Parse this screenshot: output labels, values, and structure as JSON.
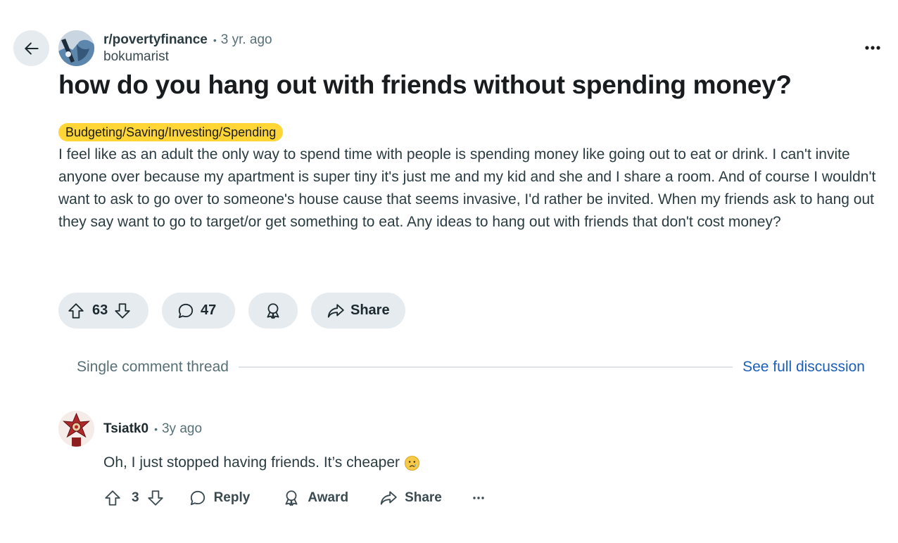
{
  "post": {
    "subreddit": "r/povertyfinance",
    "time_ago": "3 yr. ago",
    "author": "bokumarist",
    "title": "how do you hang out with friends without spending money?",
    "flair": "Budgeting/Saving/Investing/Spending",
    "body": "I feel like as an adult the only way to spend time with people is spending money like going out to eat or drink. I can't invite anyone over because my apartment is super tiny it's just me and my kid and she and I share a room. And of course I wouldn't want to ask to go over to someone's house cause that seems invasive, I'd rather be invited. When my friends ask to hang out they say want to go to target/or get something to eat. Any ideas to hang out with friends that don't cost money?",
    "upvotes": "63",
    "comments": "47",
    "share_label": "Share"
  },
  "thread": {
    "label": "Single comment thread",
    "see_full": "See full discussion"
  },
  "comment": {
    "author": "Tsiatk0",
    "time_ago": "3y ago",
    "body": "Oh, I just stopped having friends. It’s cheaper",
    "emoji": "crying-face-emoji",
    "upvotes": "3",
    "reply_label": "Reply",
    "award_label": "Award",
    "share_label": "Share"
  },
  "colors": {
    "pill_bg": "#e5ebee",
    "flair_bg": "#ffd635",
    "link": "#1b5fb8",
    "muted": "#576f76"
  }
}
